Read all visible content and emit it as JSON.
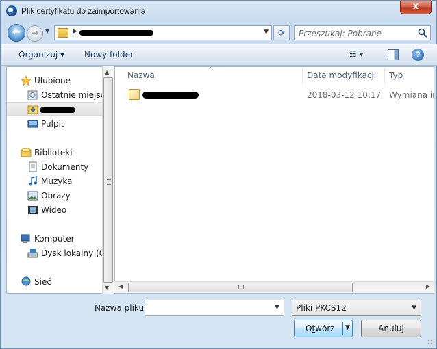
{
  "window": {
    "title": "Plik certyfikatu do zaimportowania",
    "close_label": "x"
  },
  "nav": {
    "back_glyph": "←",
    "forward_glyph": "→",
    "history_glyph": "▼",
    "address_arrow": "▶",
    "address_dropdown": "▼",
    "refresh_glyph": "⟳",
    "search_placeholder": "Przeszukaj: Pobrane"
  },
  "toolbar": {
    "organize_label": "Organizuj ▾",
    "new_folder_label": "Nowy folder",
    "views_glyph": "☷ ▾"
  },
  "sidebar": {
    "favorites": "Ulubione",
    "recent": "Ostatnie miejsca",
    "desktop": "Pulpit",
    "libraries": "Biblioteki",
    "documents": "Dokumenty",
    "music": "Muzyka",
    "pictures": "Obrazy",
    "videos": "Wideo",
    "computer": "Komputer",
    "local_disk": "Dysk lokalny (C:)",
    "network": "Sieć"
  },
  "columns": {
    "name": "Nazwa",
    "date": "Data modyfikacji",
    "type": "Typ"
  },
  "files": [
    {
      "date": "2018-03-12 10:17",
      "type": "Wymiana informacji osobistych"
    }
  ],
  "bottom": {
    "filename_label": "Nazwa pliku:",
    "filename_value": "",
    "filter_value": "Pliki PKCS12",
    "open_label_first": "O",
    "open_label_underlined": "t",
    "open_label_rest": "wórz",
    "open_arrow": "▼",
    "cancel_label": "Anuluj"
  },
  "scroll": {
    "up": "▲",
    "down": "▼",
    "left": "◀",
    "right": "▶"
  },
  "colors": {
    "accent": "#3c7fb1",
    "window_frame": "#cfe0f1",
    "close_red": "#c75a44"
  }
}
